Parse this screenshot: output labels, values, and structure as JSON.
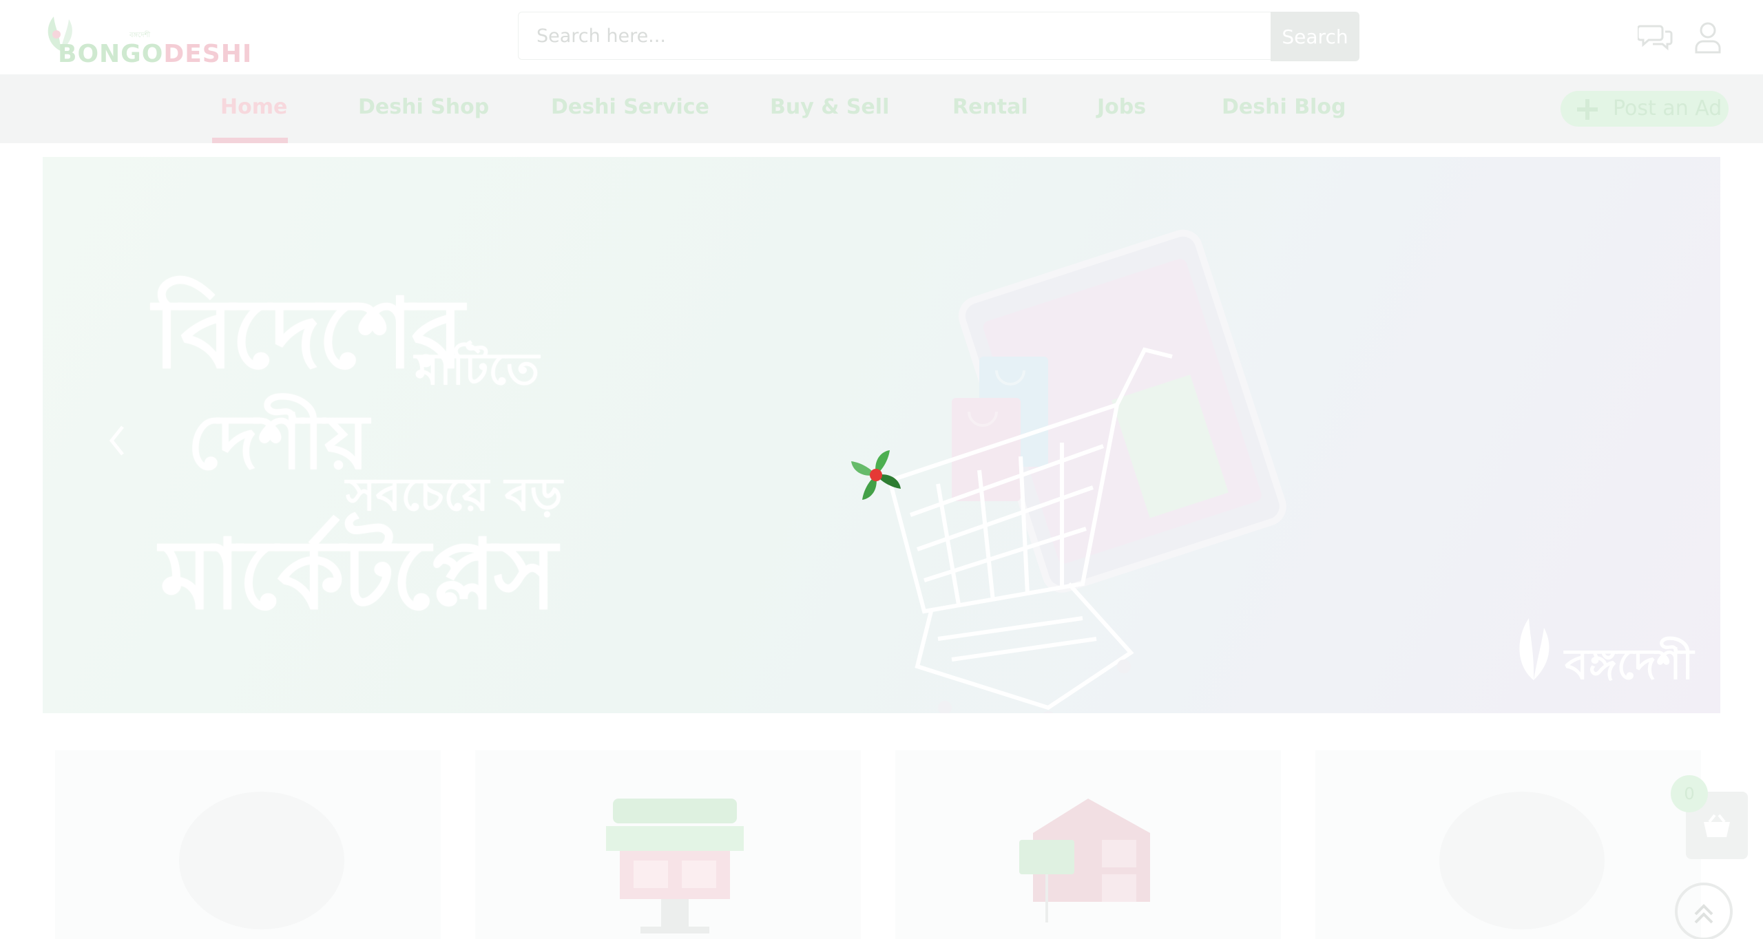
{
  "header": {
    "logo": {
      "text_a": "BONGO",
      "text_b": "DESHI",
      "tagline": "বঙ্গদেশী"
    },
    "search": {
      "placeholder": "Search here...",
      "button_label": "Search"
    },
    "icons": [
      "chat-icon",
      "user-icon"
    ]
  },
  "nav": {
    "items": [
      {
        "label": "Home",
        "active": true
      },
      {
        "label": "Deshi Shop",
        "active": false
      },
      {
        "label": "Deshi Service",
        "active": false
      },
      {
        "label": "Buy & Sell",
        "active": false
      },
      {
        "label": "Rental",
        "active": false
      },
      {
        "label": "Jobs",
        "active": false
      },
      {
        "label": "Deshi Blog",
        "active": false
      }
    ],
    "post_ad_label": "Post an Ad"
  },
  "banner": {
    "line1": "বিদেশের",
    "line2": "মাটিতে",
    "line3": "দেশীয়",
    "line4": "সবচেয়ে বড়",
    "line5": "মার্কেটপ্লেস",
    "brand": "বঙ্গদেশী"
  },
  "cart": {
    "count": "0"
  },
  "colors": {
    "brand_green": "#3aa845",
    "brand_pink": "#c8385a",
    "nav_bg": "#f3f4f4",
    "faded_overlay": "#ffffff"
  }
}
